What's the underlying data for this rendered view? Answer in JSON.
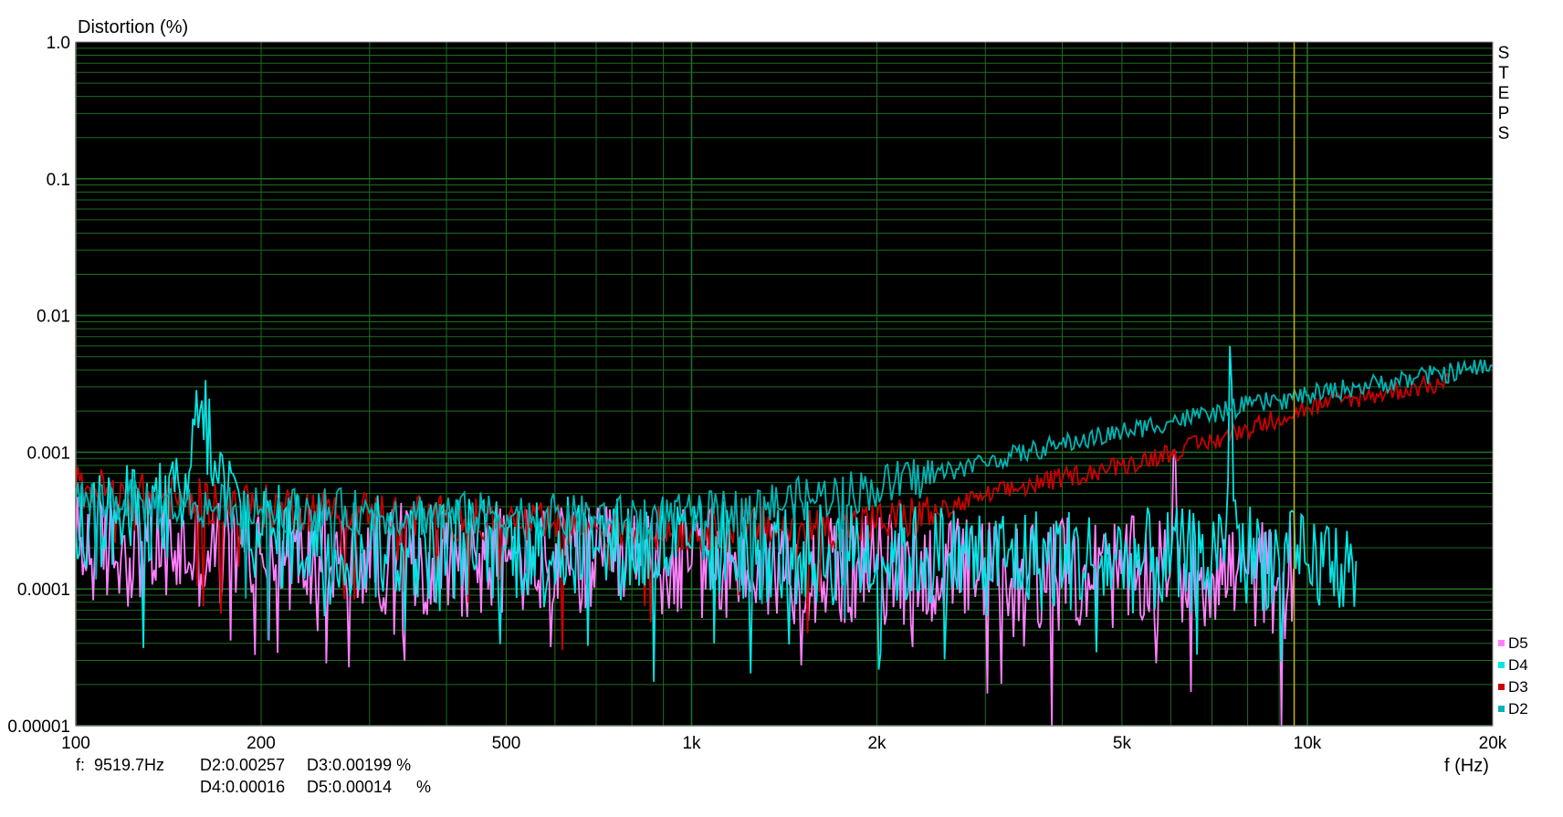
{
  "chart_data": {
    "type": "line",
    "ylabel": "Distortion (%)",
    "xlabel": "f (Hz)",
    "x_scale": "log",
    "y_scale": "log",
    "xlim": [
      100,
      20000
    ],
    "ylim": [
      1e-05,
      1.0
    ],
    "grid": true,
    "background": "#000000",
    "grid_color": "#1f6e1f",
    "yticks": [
      {
        "value": 1.0,
        "label": "1.0"
      },
      {
        "value": 0.1,
        "label": "0.1"
      },
      {
        "value": 0.01,
        "label": "0.01"
      },
      {
        "value": 0.001,
        "label": "0.001"
      },
      {
        "value": 0.0001,
        "label": "0.0001"
      },
      {
        "value": 1e-05,
        "label": "0.00001"
      }
    ],
    "xticks": [
      {
        "value": 100,
        "label": "100"
      },
      {
        "value": 200,
        "label": "200"
      },
      {
        "value": 500,
        "label": "500"
      },
      {
        "value": 1000,
        "label": "1k"
      },
      {
        "value": 2000,
        "label": "2k"
      },
      {
        "value": 5000,
        "label": "5k"
      },
      {
        "value": 10000,
        "label": "10k"
      },
      {
        "value": 20000,
        "label": "20k"
      }
    ],
    "side_label": "STEPS",
    "cursor": {
      "x": 9519.7,
      "color": "#c8b400"
    },
    "legend_position": "bottom-right",
    "series": [
      {
        "name": "D2",
        "color": "#00b4b4",
        "x": [
          100,
          120,
          150,
          180,
          200,
          250,
          300,
          400,
          500,
          700,
          1000,
          1500,
          2000,
          2500,
          3000,
          4000,
          5000,
          6000,
          7000,
          7500,
          8000,
          9000,
          10000,
          12000,
          15000,
          20000
        ],
        "y": [
          0.00045,
          0.00045,
          0.0004,
          0.0004,
          0.00038,
          0.00038,
          0.00036,
          0.00035,
          0.00035,
          0.00033,
          0.00034,
          0.00045,
          0.00055,
          0.0007,
          0.00085,
          0.00115,
          0.0014,
          0.0017,
          0.0019,
          0.00205,
          0.0022,
          0.0024,
          0.0026,
          0.003,
          0.0035,
          0.0043
        ]
      },
      {
        "name": "D3",
        "color": "#cc0000",
        "x": [
          100,
          120,
          150,
          200,
          250,
          300,
          400,
          500,
          700,
          1000,
          1500,
          2000,
          2500,
          3000,
          4000,
          5000,
          6000,
          7000,
          8000,
          9000,
          10000,
          12000,
          15000,
          17000
        ],
        "y": [
          0.00055,
          0.0005,
          0.00045,
          0.0004,
          0.00038,
          0.00036,
          0.00033,
          0.0003,
          0.00028,
          0.00027,
          0.00028,
          0.0003,
          0.00036,
          0.00048,
          0.00065,
          0.0008,
          0.001,
          0.0012,
          0.0015,
          0.0018,
          0.0021,
          0.0025,
          0.003,
          0.0032
        ]
      },
      {
        "name": "D4",
        "color": "#00e6e6",
        "x": [
          100,
          150,
          160,
          170,
          200,
          300,
          500,
          700,
          1000,
          1500,
          2000,
          3000,
          5000,
          7000,
          7400,
          7500,
          7600,
          8000,
          9000,
          10000,
          11000,
          12000
        ],
        "y": [
          0.00028,
          0.0004,
          0.0025,
          0.0006,
          0.00025,
          0.0002,
          0.0002,
          0.0002,
          0.0002,
          0.00018,
          0.00018,
          0.00017,
          0.00016,
          0.00016,
          0.0003,
          0.0098,
          0.0003,
          0.00018,
          0.00016,
          0.00015,
          0.00016,
          0.00016
        ]
      },
      {
        "name": "D5",
        "color": "#ff80ff",
        "x": [
          100,
          200,
          500,
          1000,
          2000,
          3000,
          5000,
          6000,
          6100,
          6200,
          7000,
          8000,
          9000,
          9500
        ],
        "y": [
          0.0002,
          0.00018,
          0.00016,
          0.00015,
          0.00014,
          0.00013,
          0.00013,
          0.00013,
          0.0011,
          0.00013,
          0.00013,
          0.00013,
          0.00012,
          0.00014
        ]
      }
    ]
  },
  "readout": {
    "freq": "f:  9519.7Hz",
    "d2": "D2:0.00257",
    "d3": "D3:0.00199 %",
    "d4": "D4:0.00016",
    "d5": "D5:0.00014",
    "unit": "%"
  }
}
